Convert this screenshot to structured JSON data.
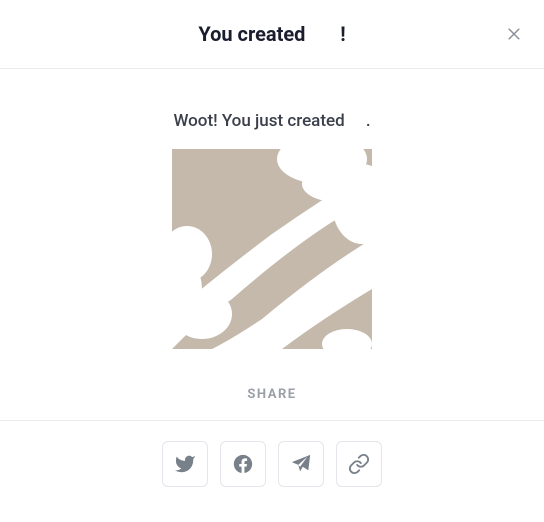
{
  "header": {
    "title": "You created       !"
  },
  "body": {
    "subtitle": "Woot! You just created     ."
  },
  "share": {
    "label": "SHARE"
  },
  "icons": {
    "close": "close-icon",
    "twitter": "twitter-icon",
    "facebook": "facebook-icon",
    "telegram": "telegram-icon",
    "link": "link-icon"
  }
}
